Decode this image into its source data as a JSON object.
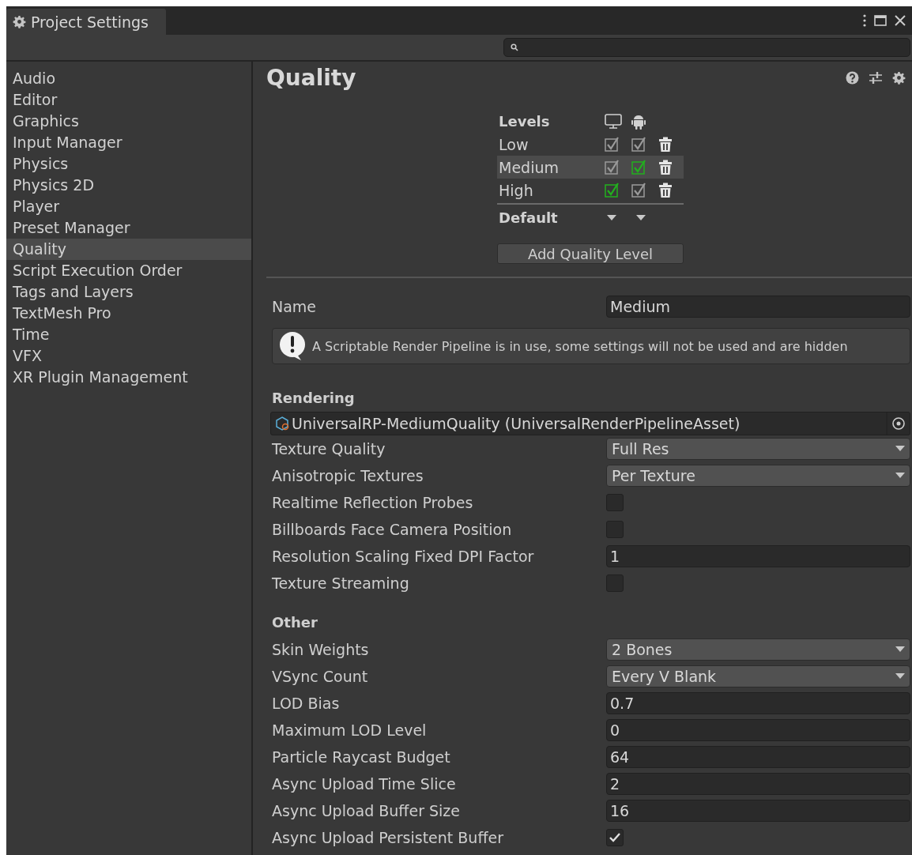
{
  "window": {
    "tab_title": "Project Settings"
  },
  "sidebar": {
    "items": [
      {
        "label": "Audio",
        "selected": false
      },
      {
        "label": "Editor",
        "selected": false
      },
      {
        "label": "Graphics",
        "selected": false
      },
      {
        "label": "Input Manager",
        "selected": false
      },
      {
        "label": "Physics",
        "selected": false
      },
      {
        "label": "Physics 2D",
        "selected": false
      },
      {
        "label": "Player",
        "selected": false
      },
      {
        "label": "Preset Manager",
        "selected": false
      },
      {
        "label": "Quality",
        "selected": true
      },
      {
        "label": "Script Execution Order",
        "selected": false
      },
      {
        "label": "Tags and Layers",
        "selected": false
      },
      {
        "label": "TextMesh Pro",
        "selected": false
      },
      {
        "label": "Time",
        "selected": false
      },
      {
        "label": "VFX",
        "selected": false
      },
      {
        "label": "XR Plugin Management",
        "selected": false
      }
    ]
  },
  "page": {
    "title": "Quality",
    "levels": {
      "heading": "Levels",
      "default_label": "Default",
      "add_button": "Add Quality Level",
      "rows": [
        {
          "name": "Low",
          "selected": false,
          "platforms": [
            {
              "checked": true,
              "default": false
            },
            {
              "checked": true,
              "default": false
            }
          ]
        },
        {
          "name": "Medium",
          "selected": true,
          "platforms": [
            {
              "checked": true,
              "default": false
            },
            {
              "checked": true,
              "default": true
            }
          ]
        },
        {
          "name": "High",
          "selected": false,
          "platforms": [
            {
              "checked": true,
              "default": true
            },
            {
              "checked": true,
              "default": false
            }
          ]
        }
      ]
    },
    "name_field": {
      "label": "Name",
      "value": "Medium"
    },
    "notice": "A Scriptable Render Pipeline is in use, some settings will not be used and are hidden",
    "sections": [
      {
        "heading": "Rendering",
        "rows": [
          {
            "kind": "asset",
            "value": "UniversalRP-MediumQuality (UniversalRenderPipelineAsset)"
          },
          {
            "kind": "dropdown",
            "label": "Texture Quality",
            "value": "Full Res"
          },
          {
            "kind": "dropdown",
            "label": "Anisotropic Textures",
            "value": "Per Texture"
          },
          {
            "kind": "checkbox",
            "label": "Realtime Reflection Probes",
            "checked": false
          },
          {
            "kind": "checkbox",
            "label": "Billboards Face Camera Position",
            "checked": false
          },
          {
            "kind": "field",
            "label": "Resolution Scaling Fixed DPI Factor",
            "value": "1"
          },
          {
            "kind": "checkbox",
            "label": "Texture Streaming",
            "checked": false
          }
        ]
      },
      {
        "heading": "Other",
        "rows": [
          {
            "kind": "dropdown",
            "label": "Skin Weights",
            "value": "2 Bones"
          },
          {
            "kind": "dropdown",
            "label": "VSync Count",
            "value": "Every V Blank"
          },
          {
            "kind": "field",
            "label": "LOD Bias",
            "value": "0.7"
          },
          {
            "kind": "field",
            "label": "Maximum LOD Level",
            "value": "0"
          },
          {
            "kind": "field",
            "label": "Particle Raycast Budget",
            "value": "64"
          },
          {
            "kind": "field",
            "label": "Async Upload Time Slice",
            "value": "2"
          },
          {
            "kind": "field",
            "label": "Async Upload Buffer Size",
            "value": "16"
          },
          {
            "kind": "checkbox",
            "label": "Async Upload Persistent Buffer",
            "checked": true
          }
        ]
      }
    ]
  }
}
